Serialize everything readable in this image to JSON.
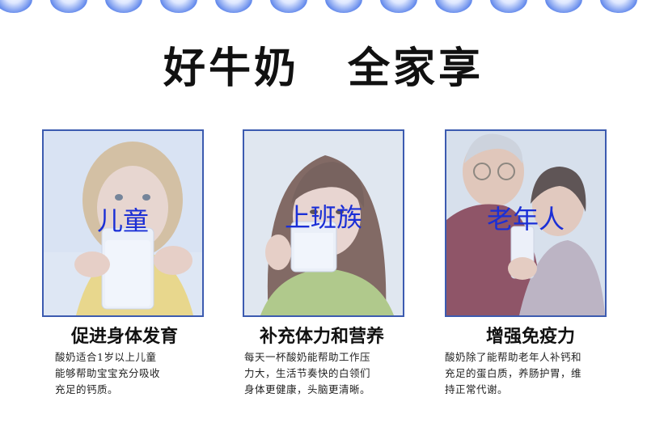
{
  "headline": {
    "part1": "好牛奶",
    "part2": "全家享"
  },
  "cards": [
    {
      "tag": "儿童",
      "title": "促进身体发育",
      "desc": [
        "酸奶适合1岁以上儿童",
        "能够帮助宝宝充分吸收",
        "充足的钙质。"
      ]
    },
    {
      "tag": "上班族",
      "title": "补充体力和营养",
      "desc": [
        "每天一杯酸奶能帮助工作压",
        "力大，生活节奏快的白领们",
        "身体更健康，头脑更清晰。"
      ]
    },
    {
      "tag": "老年人",
      "title": "增强免疫力",
      "desc": [
        "酸奶除了能帮助老年人补钙和",
        "充足的蛋白质，养肠护胃，维",
        "持正常代谢。"
      ]
    }
  ],
  "colors": {
    "accent": "#3c5bb0",
    "tag_text": "#1b2fd6",
    "scallop": "#4f7ae8"
  }
}
